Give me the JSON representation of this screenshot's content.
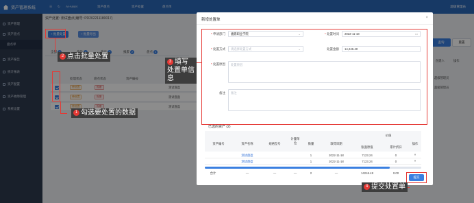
{
  "app": {
    "title": "资产管理系统",
    "user": "超级管理员"
  },
  "topbar": {
    "crumbs": [
      "AI-Asset",
      "资产盘点",
      "资产处置",
      "盘点单"
    ]
  },
  "sidebar": {
    "items": [
      "资产管理",
      "资产盘点",
      "盘点单",
      "资产报告",
      "统计报表",
      "资产配置",
      "资产故障管理",
      "系统设置"
    ]
  },
  "page": {
    "subheader": "资产处置: 测试盘点(编号: PD202211180017)",
    "batch_button": "+ 批量处置",
    "export_button": "+ 批量导出",
    "tabs": [
      {
        "label": "全部",
        "count": "2"
      },
      {
        "label": "盘盈",
        "count": "0"
      },
      {
        "label": "盘亏",
        "count": "0"
      },
      {
        "label": "报废",
        "count": "2"
      },
      {
        "label": "盘点",
        "count": "0"
      }
    ],
    "columns": [
      "处理状态",
      "盘点状态",
      "资产编号"
    ],
    "rows": [
      {
        "status": "待处置",
        "check": "报废",
        "name": "测试盘盈"
      },
      {
        "status": "待处置",
        "check": "报废",
        "name": "测试盘盈"
      },
      {
        "status": "待处置",
        "check": "报废",
        "name": "测试盘盈"
      }
    ],
    "right": {
      "search": "查询",
      "reset": "重置",
      "col_creator": "创建人",
      "col_op": "操作",
      "creator": "超级管理员"
    }
  },
  "modal": {
    "title": "新增处置单",
    "fields": {
      "dept_label": "申请部门",
      "dept_value": "嘉鼎职业学院",
      "date_label": "处置时间",
      "date_value": "2022-11-18",
      "method_label": "处置方式",
      "method_placeholder": "请选择处置方式",
      "amount_label": "处置金额",
      "amount_value": "14,246.40",
      "reason_label": "处置原因",
      "reason_placeholder": "处置原因",
      "remark_label": "备注",
      "remark_placeholder": "备注"
    },
    "selected_title": "已选的资产 (2)",
    "table": {
      "headers": [
        "资产编号",
        "资产名称",
        "规格型号",
        "计量单位",
        "数量",
        "取得日期",
        "价值",
        "账面原值",
        "累计折旧",
        "操作"
      ],
      "rows": [
        {
          "name": "测试盘盈",
          "qty": "1",
          "date": "2022-11-18",
          "orig": "7123.24",
          "dep": "0",
          "op": "×"
        },
        {
          "name": "测试盘盈",
          "qty": "1",
          "date": "2022-11-18",
          "orig": "7123.24",
          "dep": "0",
          "op": "×"
        }
      ],
      "total": {
        "label": "合计",
        "dash": "—",
        "qty": "2",
        "orig": "14246.48",
        "dep": "0.00"
      }
    },
    "submit": "提交"
  },
  "notes": {
    "n1": {
      "num": "1",
      "text": "勾选要处置的数据"
    },
    "n2": {
      "num": "2",
      "text": "点击批量处置"
    },
    "n3": {
      "num": "3",
      "text": "填写处置单信息"
    },
    "n4": {
      "num": "4",
      "text": "提交处置单"
    }
  }
}
